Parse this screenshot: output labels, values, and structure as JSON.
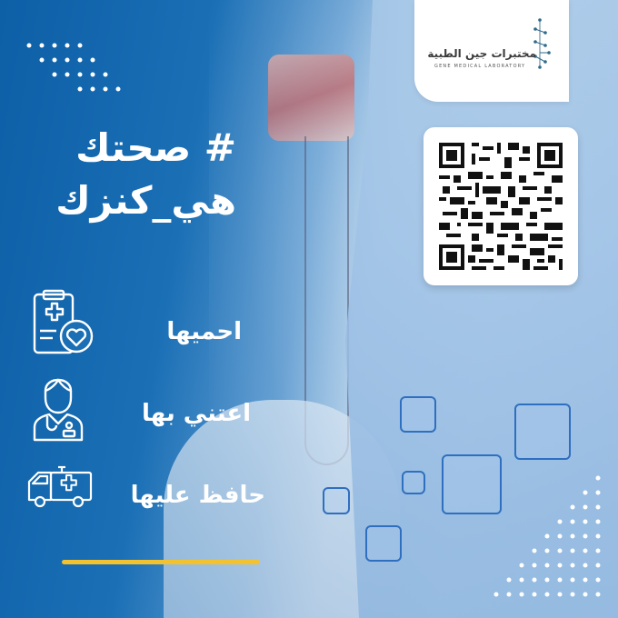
{
  "logo": {
    "name_ar": "مختبرات جين الطبية",
    "name_en": "GENE MEDICAL LABORATORY"
  },
  "headline": {
    "line1": "# صحتك",
    "line2": "هي_كنزك"
  },
  "items": [
    {
      "label": "احميها",
      "icon": "clipboard-heart-icon"
    },
    {
      "label": "اعتني بها",
      "icon": "doctor-icon"
    },
    {
      "label": "حافظ عليها",
      "icon": "ambulance-icon"
    }
  ],
  "colors": {
    "primary": "#0d5fa6",
    "accent": "#f2c230",
    "text": "#ffffff"
  }
}
